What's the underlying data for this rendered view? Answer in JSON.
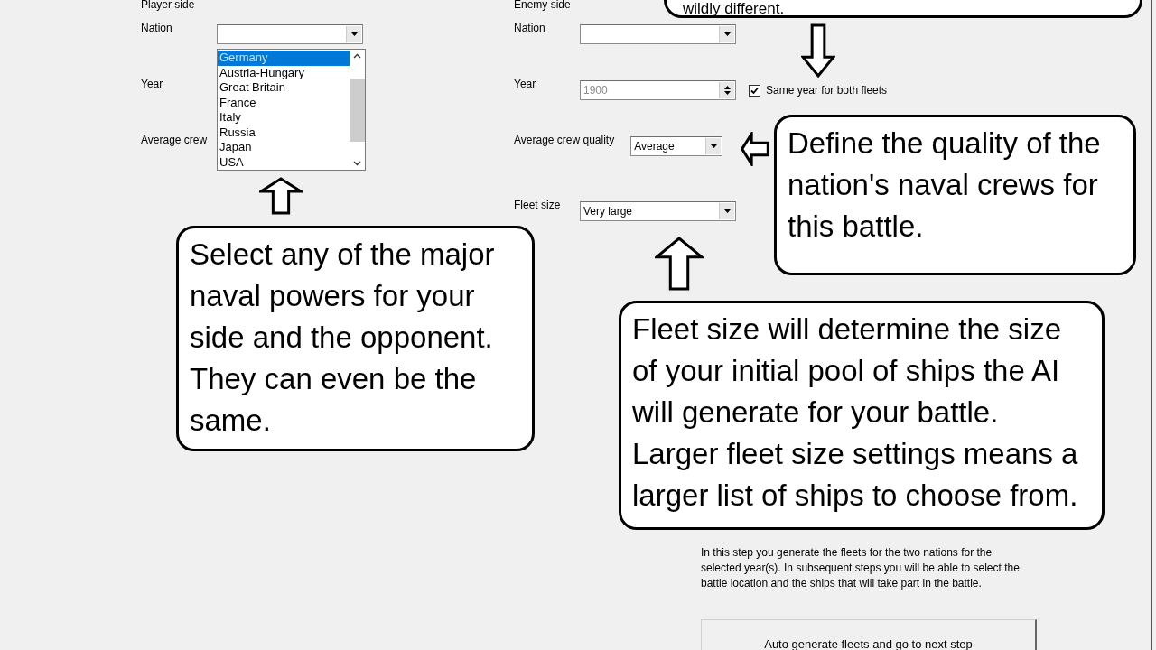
{
  "player_side": {
    "title": "Player side",
    "labels": [
      "Nation",
      "Year",
      "Average crew"
    ],
    "nation_list": [
      {
        "label": "Germany",
        "selected": true
      },
      {
        "label": "Austria-Hungary",
        "selected": false
      },
      {
        "label": "Great Britain",
        "selected": false
      },
      {
        "label": "France",
        "selected": false
      },
      {
        "label": "Italy",
        "selected": false
      },
      {
        "label": "Russia",
        "selected": false
      },
      {
        "label": "Japan",
        "selected": false
      },
      {
        "label": "USA",
        "selected": false
      }
    ]
  },
  "enemy_side": {
    "title": "Enemy side",
    "nation": {
      "label": "Nation"
    },
    "year": {
      "label": "Year",
      "value": "1900",
      "disabled": true
    },
    "same_year": {
      "label": "Same year for both fleets",
      "checked": true
    },
    "crew_quality": {
      "label": "Average crew quality",
      "value": "Average"
    },
    "fleet_size": {
      "label": "Fleet size",
      "value": "Very large"
    }
  },
  "description": "In this step you generate the fleets for the two nations for the selected year(s). In subsequent steps you will be able to select the battle location and the ships that will take part in the battle.",
  "next_button": "Auto generate fleets and go to next step",
  "callouts": [
    {
      "text": "wildly different."
    },
    {
      "text": "Define the quality of the nation's naval crews for this battle."
    },
    {
      "text": "Select any of the major naval powers for your side and the opponent. They can even be the same."
    },
    {
      "text": "Fleet size will determine the size of your initial pool of ships the AI will generate for your battle. Larger fleet size settings means a larger list of ships to choose from."
    }
  ],
  "arrows": [
    {
      "kind": "down"
    },
    {
      "kind": "up"
    },
    {
      "kind": "left"
    },
    {
      "kind": "up"
    }
  ]
}
